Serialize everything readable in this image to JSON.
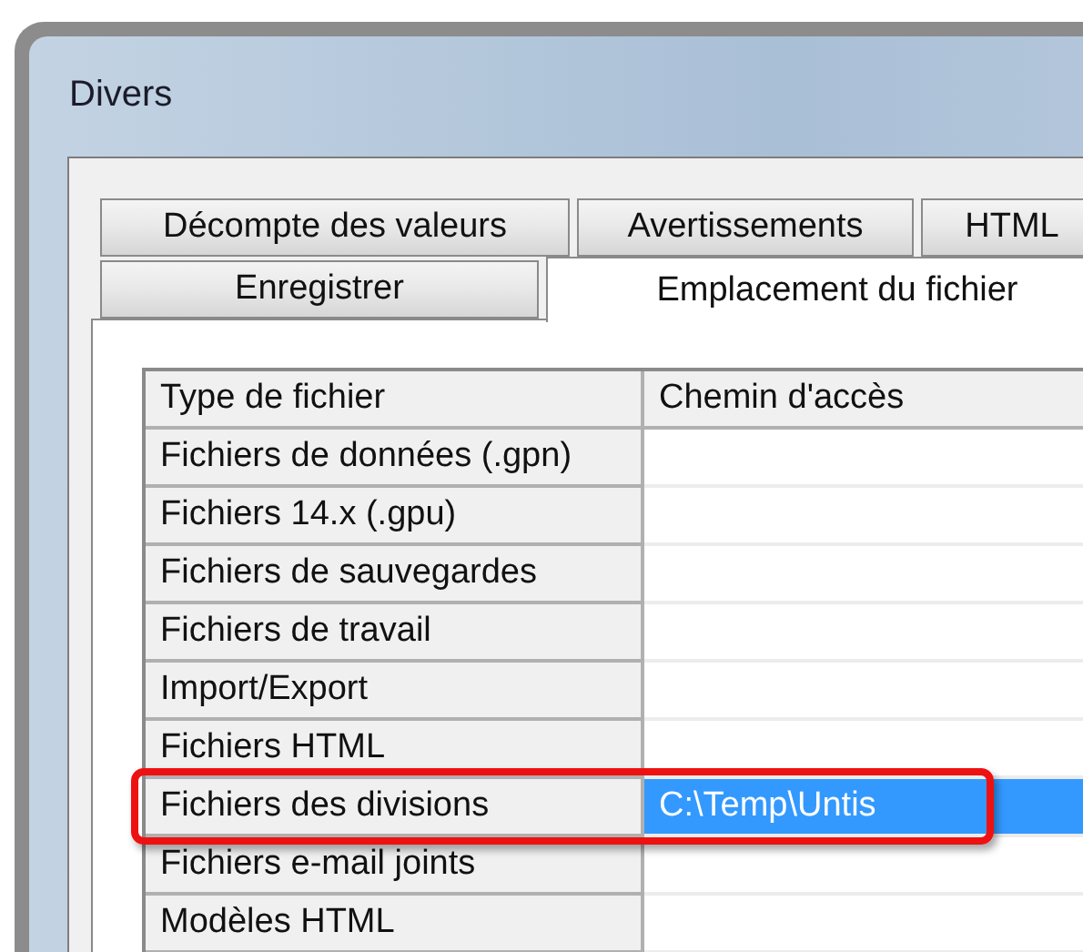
{
  "window": {
    "title": "Divers"
  },
  "tab_rows": [
    [
      {
        "label": "Décompte des valeurs",
        "selected": false
      },
      {
        "label": "Avertissements",
        "selected": false
      },
      {
        "label": "HTML",
        "selected": false
      }
    ],
    [
      {
        "label": "Enregistrer",
        "selected": false
      },
      {
        "label": "Emplacement du fichier",
        "selected": true
      }
    ]
  ],
  "table": {
    "columns": [
      "Type de fichier",
      "Chemin d'accès"
    ],
    "rows": [
      {
        "type": "Fichiers de données (.gpn)",
        "path": "",
        "selected": false,
        "highlighted": false
      },
      {
        "type": "Fichiers 14.x (.gpu)",
        "path": "",
        "selected": false,
        "highlighted": false
      },
      {
        "type": "Fichiers de sauvegardes",
        "path": "",
        "selected": false,
        "highlighted": false
      },
      {
        "type": "Fichiers de travail",
        "path": "",
        "selected": false,
        "highlighted": false
      },
      {
        "type": "Import/Export",
        "path": "",
        "selected": false,
        "highlighted": false
      },
      {
        "type": "Fichiers HTML",
        "path": "",
        "selected": false,
        "highlighted": false
      },
      {
        "type": "Fichiers des divisions",
        "path": "C:\\Temp\\Untis",
        "selected": true,
        "highlighted": true
      },
      {
        "type": "Fichiers e-mail joints",
        "path": "",
        "selected": false,
        "highlighted": false
      },
      {
        "type": "Modèles HTML",
        "path": "",
        "selected": false,
        "highlighted": false
      }
    ]
  }
}
